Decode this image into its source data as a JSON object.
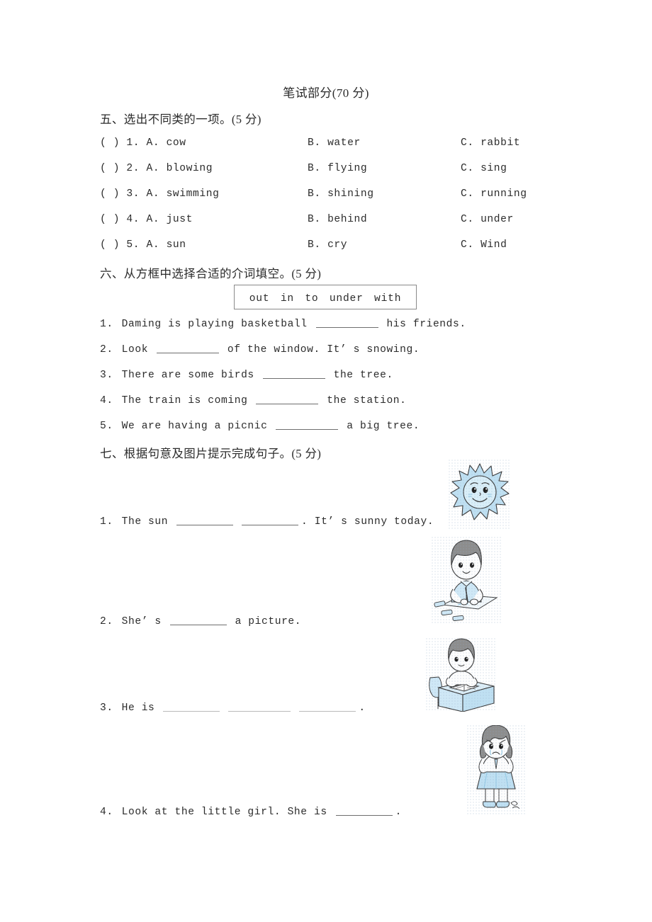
{
  "title": "笔试部分(70 分)",
  "sections": {
    "five": {
      "heading": "五、选出不同类的一项。(5 分)",
      "rows": [
        {
          "stem": "(  ) 1. A. cow",
          "b": "B. water",
          "c": "C. rabbit"
        },
        {
          "stem": "(  ) 2. A. blowing",
          "b": "B. flying",
          "c": "C. sing"
        },
        {
          "stem": "(  ) 3. A. swimming",
          "b": "B. shining",
          "c": "C. running"
        },
        {
          "stem": "(  ) 4. A. just",
          "b": "B. behind",
          "c": "C. under"
        },
        {
          "stem": "(  ) 5. A. sun",
          "b": "B. cry",
          "c": "C. Wind"
        }
      ]
    },
    "six": {
      "heading": "六、从方框中选择合适的介词填空。(5 分)",
      "word_bank": "out　in　to　under　with",
      "items": [
        {
          "num": "1.",
          "pre": "Daming is playing basketball",
          "post": "his friends."
        },
        {
          "num": "2.",
          "pre": "Look",
          "post": "of the window. It’ s snowing."
        },
        {
          "num": "3.",
          "pre": "There are some birds",
          "post": "the tree."
        },
        {
          "num": "4.",
          "pre": "The train is coming",
          "post": "the station."
        },
        {
          "num": "5.",
          "pre": "We are having a picnic",
          "post": "a big tree."
        }
      ]
    },
    "seven": {
      "heading": "七、根据句意及图片提示完成句子。(5 分)",
      "items": [
        {
          "num": "1.",
          "pre": "The sun",
          "post": ". It’ s sunny today.",
          "blanks": 2,
          "picture": "smiling-sun"
        },
        {
          "num": "2.",
          "pre": "She’ s",
          "post": "a picture.",
          "blanks": 1,
          "picture": "girl-drawing-picture"
        },
        {
          "num": "3.",
          "pre": "He is",
          "post": ".",
          "blanks": 3,
          "picture": "boy-reading-at-desk"
        },
        {
          "num": "4.",
          "pre": "Look at the little girl. She is",
          "post": ".",
          "blanks": 1,
          "picture": "crying-girl"
        }
      ]
    }
  },
  "colors": {
    "ink": "#2b2b2b",
    "rule": "#6e6e6e",
    "box_border": "#8a8a8a",
    "art_blue": "#bfe0f2",
    "art_blue_dark": "#8ec7e4",
    "art_hair": "#8d8d8d",
    "art_outline": "#3a3a3a"
  }
}
